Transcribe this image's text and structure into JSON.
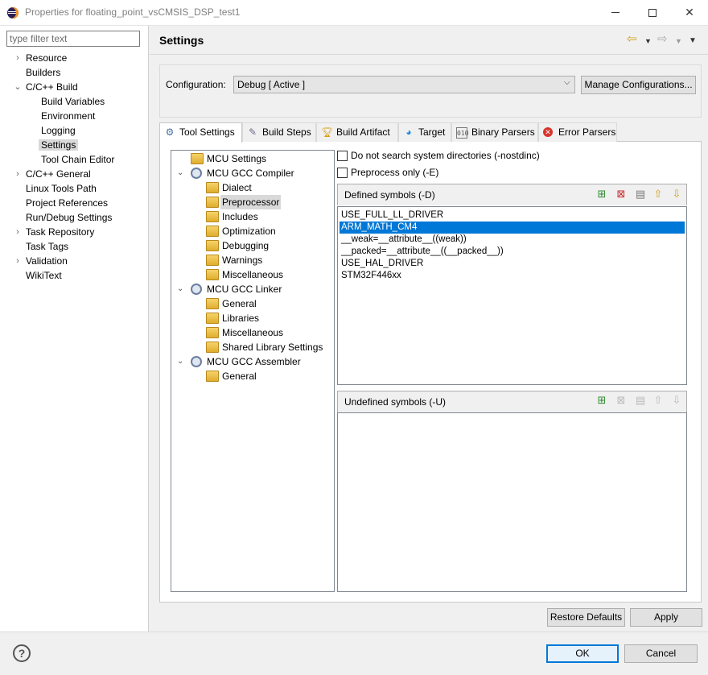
{
  "window": {
    "title": "Properties for floating_point_vsCMSIS_DSP_test1"
  },
  "filter": {
    "placeholder": "type filter text"
  },
  "nav": {
    "items": [
      {
        "label": "Resource",
        "expander": "›"
      },
      {
        "label": "Builders",
        "expander": ""
      },
      {
        "label": "C/C++ Build",
        "expander": "⌄"
      },
      {
        "label": "Build Variables",
        "expander": ""
      },
      {
        "label": "Environment",
        "expander": ""
      },
      {
        "label": "Logging",
        "expander": ""
      },
      {
        "label": "Settings",
        "expander": "",
        "selected": true
      },
      {
        "label": "Tool Chain Editor",
        "expander": ""
      },
      {
        "label": "C/C++ General",
        "expander": "›"
      },
      {
        "label": "Linux Tools Path",
        "expander": ""
      },
      {
        "label": "Project References",
        "expander": ""
      },
      {
        "label": "Run/Debug Settings",
        "expander": ""
      },
      {
        "label": "Task Repository",
        "expander": "›"
      },
      {
        "label": "Task Tags",
        "expander": ""
      },
      {
        "label": "Validation",
        "expander": "›"
      },
      {
        "label": "WikiText",
        "expander": ""
      }
    ]
  },
  "header": {
    "title": "Settings"
  },
  "config": {
    "label": "Configuration:",
    "value": "Debug  [ Active ]",
    "manage_label": "Manage Configurations..."
  },
  "tabs": [
    {
      "label": "Tool Settings",
      "icon": "tool-settings-icon"
    },
    {
      "label": "Build Steps",
      "icon": "build-steps-icon"
    },
    {
      "label": "Build Artifact",
      "icon": "trophy-icon"
    },
    {
      "label": "Target",
      "icon": "globe-icon"
    },
    {
      "label": "Binary Parsers",
      "icon": "binary-icon"
    },
    {
      "label": "Error Parsers",
      "icon": "error-icon"
    }
  ],
  "tool_tree": [
    {
      "label": "MCU Settings"
    },
    {
      "label": "MCU GCC Compiler"
    },
    {
      "label": "Dialect"
    },
    {
      "label": "Preprocessor"
    },
    {
      "label": "Includes"
    },
    {
      "label": "Optimization"
    },
    {
      "label": "Debugging"
    },
    {
      "label": "Warnings"
    },
    {
      "label": "Miscellaneous"
    },
    {
      "label": "MCU GCC Linker"
    },
    {
      "label": "General"
    },
    {
      "label": "Libraries"
    },
    {
      "label": "Miscellaneous"
    },
    {
      "label": "Shared Library Settings"
    },
    {
      "label": "MCU GCC Assembler"
    },
    {
      "label": "General"
    }
  ],
  "options": {
    "nostdinc_label": "Do not search system directories (-nostdinc)",
    "preprocess_only_label": "Preprocess only (-E)"
  },
  "defined": {
    "header": "Defined symbols (-D)",
    "items": [
      "USE_FULL_LL_DRIVER",
      "ARM_MATH_CM4",
      "__weak=__attribute__((weak))",
      "__packed=__attribute__((__packed__))",
      "USE_HAL_DRIVER",
      "STM32F446xx"
    ]
  },
  "undefined": {
    "header": "Undefined symbols (-U)"
  },
  "buttons": {
    "restore_defaults": "Restore Defaults",
    "apply": "Apply",
    "ok": "OK",
    "cancel": "Cancel",
    "help": "?"
  }
}
